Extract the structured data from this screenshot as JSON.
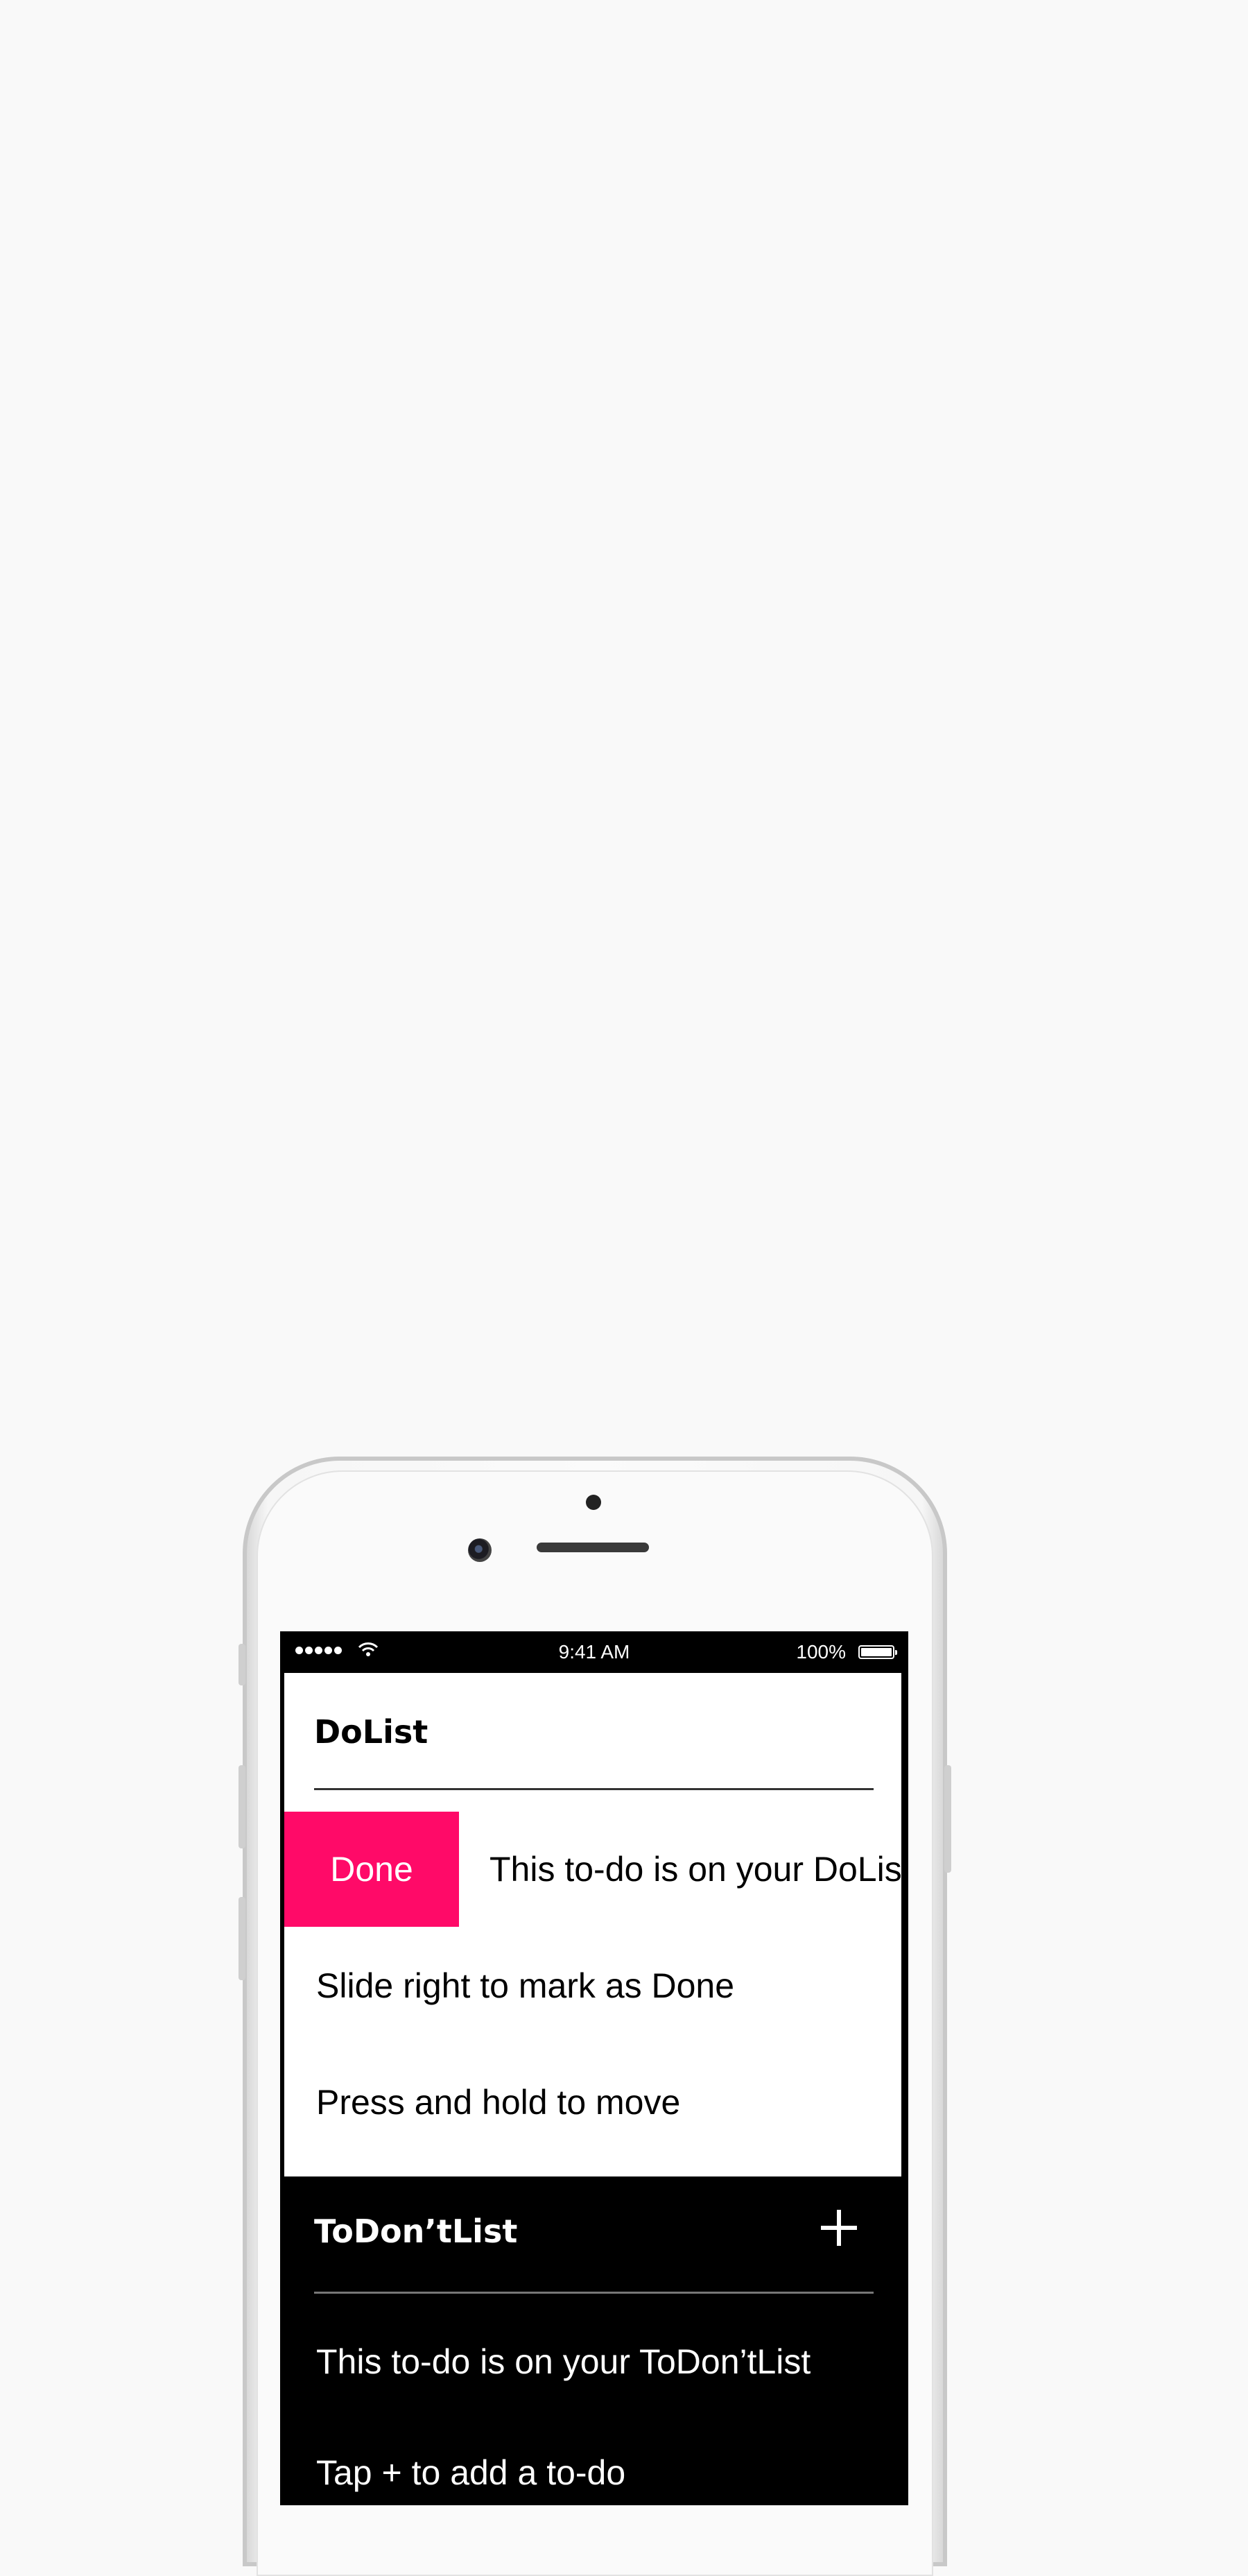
{
  "status_bar": {
    "time": "9:41 AM",
    "battery": "100%",
    "signal_bars": 5
  },
  "do_list": {
    "title": "DoList",
    "swipe_action": "Done",
    "items": [
      "This to-do is on your DoList",
      "Slide right to mark as Done",
      "Press and hold to move"
    ]
  },
  "dont_list": {
    "title": "ToDon’tList",
    "add_icon": "plus-icon",
    "items": [
      "This to-do is on your ToDon’tList",
      "Tap + to add a to-do"
    ]
  },
  "colors": {
    "accent": "#ff0a68",
    "background": "#f9f9f9",
    "panel_dark": "#000000"
  }
}
